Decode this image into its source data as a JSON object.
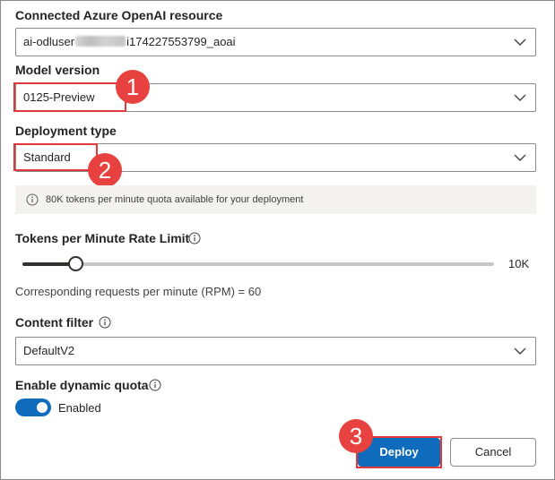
{
  "resource": {
    "label": "Connected Azure OpenAI resource",
    "value_prefix": "ai-odluser",
    "value_suffix": "i174227553799_aoai"
  },
  "model_version": {
    "label": "Model version",
    "value": "0125-Preview"
  },
  "deployment_type": {
    "label": "Deployment type",
    "value": "Standard"
  },
  "quota_info": {
    "text": "80K tokens per minute quota available for your deployment"
  },
  "rate_limit": {
    "label": "Tokens per Minute Rate Limit",
    "value_label": "10K",
    "slider_fraction": 0.113,
    "rpm_text": "Corresponding requests per minute (RPM) = 60"
  },
  "content_filter": {
    "label": "Content filter",
    "value": "DefaultV2"
  },
  "dynamic_quota": {
    "label": "Enable dynamic quota",
    "state_label": "Enabled",
    "enabled": true
  },
  "buttons": {
    "deploy": "Deploy",
    "cancel": "Cancel"
  },
  "callouts": {
    "one": "1",
    "two": "2",
    "three": "3"
  },
  "colors": {
    "accent": "#0f6cbd",
    "callout": "#e7423f"
  },
  "icons": {
    "chevron": "chevron-down-icon",
    "info": "info-icon"
  }
}
